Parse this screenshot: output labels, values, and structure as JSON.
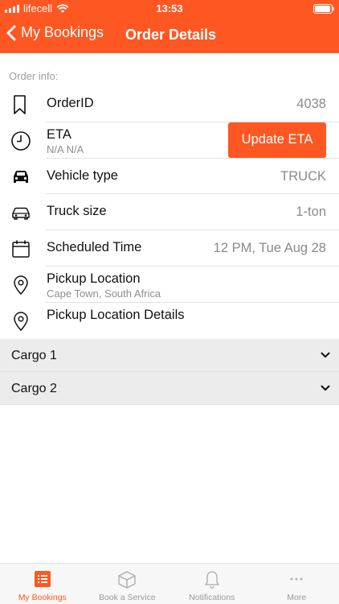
{
  "status_bar": {
    "carrier": "lifecell",
    "time": "13:53"
  },
  "nav": {
    "back_label": "My Bookings",
    "title": "Order Details"
  },
  "order_info": {
    "section_label": "Order info:",
    "order_id": {
      "label": "OrderID",
      "value": "4038"
    },
    "eta": {
      "label": "ETA",
      "sub": "N/A N/A",
      "button": "Update ETA"
    },
    "vehicle_type": {
      "label": "Vehicle type",
      "value": "TRUCK"
    },
    "truck_size": {
      "label": "Truck size",
      "value": "1-ton"
    },
    "scheduled_time": {
      "label": "Scheduled Time",
      "value": "12 PM, Tue Aug 28"
    },
    "pickup_location": {
      "label": "Pickup Location",
      "sub": "Cape Town, South Africa"
    },
    "pickup_details": {
      "label": "Pickup Location Details"
    }
  },
  "cargo": [
    {
      "label": "Cargo 1"
    },
    {
      "label": "Cargo 2"
    }
  ],
  "tabs": [
    {
      "label": "My Bookings",
      "icon": "list-icon",
      "active": true
    },
    {
      "label": "Book a Service",
      "icon": "box-icon",
      "active": false
    },
    {
      "label": "Notifications",
      "icon": "bell-icon",
      "active": false
    },
    {
      "label": "More",
      "icon": "more-icon",
      "active": false
    }
  ],
  "colors": {
    "accent": "#FF5722",
    "muted": "#9e9e9e",
    "cargo_bg": "#ececec"
  }
}
